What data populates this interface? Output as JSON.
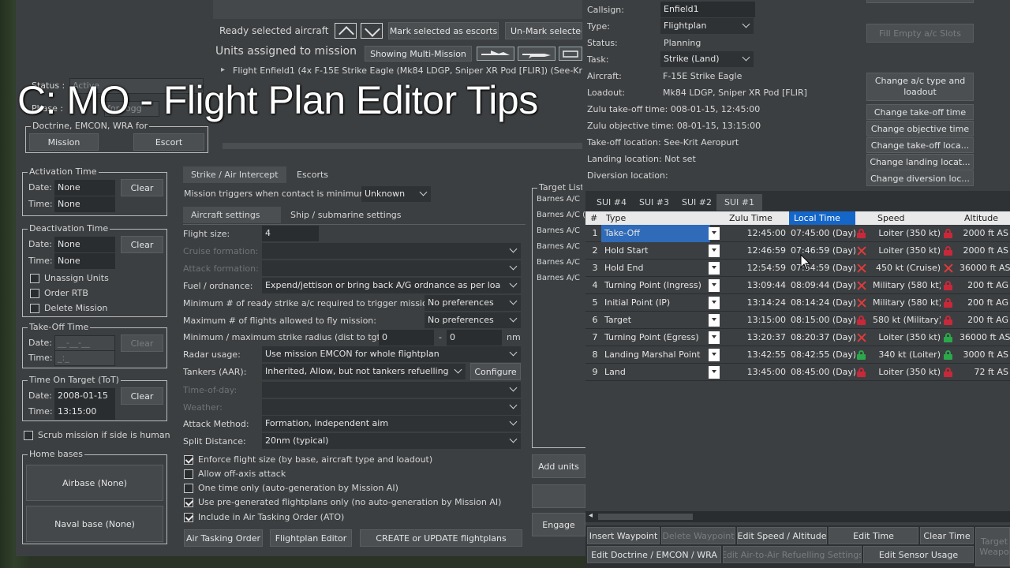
{
  "overlay": {
    "title": "C: MO - Flight Plan Editor Tips"
  },
  "mission_top": {
    "status_label": "Status :",
    "status_value": "Active",
    "phase_label": "Phase :",
    "phase_value": "for togg",
    "doctrine_legend": "Doctrine, EMCON, WRA for",
    "mission_btn": "Mission",
    "escort_btn": "Escort",
    "ready_selected": "Ready selected aircraft",
    "mark_escorts": "Mark selected as escorts",
    "unmark_selected": "Un-Mark selected",
    "units_assigned": "Units assigned to mission",
    "showing_multi": "Showing Multi-Mission",
    "flight_line": "Flight Enfield1 (4x F-15E Strike Eagle (Mk84 LDGP, Sniper XR Pod [FLIR]) (See-Krit Aerop"
  },
  "activation": {
    "legend": "Activation Time",
    "date_label": "Date:",
    "date": "None",
    "time_label": "Time:",
    "time": "None",
    "clear": "Clear"
  },
  "deactivation": {
    "legend": "Deactivation Time",
    "date_label": "Date:",
    "date": "None",
    "time_label": "Time:",
    "time": "None",
    "clear": "Clear",
    "unassign": "Unassign Units",
    "order_rtb": "Order RTB",
    "delete_mission": "Delete Mission"
  },
  "takeoff": {
    "legend": "Take-Off Time",
    "date_label": "Date:",
    "date": "__-__-__",
    "time_label": "Time:",
    "time": "_:_",
    "clear": "Clear"
  },
  "tot": {
    "legend": "Time On Target (ToT)",
    "date_label": "Date:",
    "date": "2008-01-15",
    "time_label": "Time:",
    "time": "13:15:00",
    "clear": "Clear"
  },
  "scrub": "Scrub mission if side is human",
  "home_bases": {
    "legend": "Home bases",
    "airbase": "Airbase (None)",
    "naval": "Naval base (None)"
  },
  "tabs": {
    "strike": "Strike / Air Intercept",
    "escorts": "Escorts",
    "aircraft_settings": "Aircraft settings",
    "ship_settings": "Ship / submarine settings"
  },
  "settings": {
    "triggers_label": "Mission triggers when contact is minimum:",
    "triggers_value": "Unknown",
    "flight_size_label": "Flight size:",
    "flight_size": "4",
    "cruise_formation": "Cruise formation:",
    "attack_formation": "Attack formation:",
    "fuel_label": "Fuel / ordnance:",
    "fuel_value": "Expend/jettison or bring back A/G ordnance as per loa",
    "min_ready_label": "Minimum # of ready strike a/c required to trigger mission:",
    "min_ready_value": "No preferences",
    "max_flights_label": "Maximum # of flights allowed to fly mission:",
    "max_flights_value": "No preferences",
    "radius_label": "Minimum / maximum strike radius (dist to tgt):",
    "radius_min": "0",
    "radius_max": "0",
    "radius_unit": "nm",
    "radar_label": "Radar usage:",
    "radar_value": "Use mission EMCON for whole flightplan",
    "tankers_label": "Tankers (AAR):",
    "tankers_value": "Inherited, Allow, but not tankers refuelling",
    "configure": "Configure",
    "time_of_day": "Time-of-day:",
    "weather": "Weather:",
    "attack_method_label": "Attack Method:",
    "attack_method_value": "Formation, independent aim",
    "split_label": "Split Distance:",
    "split_value": "20nm (typical)",
    "enforce": "Enforce flight size (by base, aircraft type and loadout)",
    "off_axis": "Allow off-axis attack",
    "one_time": "One time only (auto-generation by Mission AI)",
    "pregenerated": "Use pre-generated flightplans only (no auto-generation by Mission AI)",
    "ato": "Include in Air Tasking Order (ATO)",
    "btn_ato": "Air Tasking Order",
    "btn_fpe": "Flightplan Editor",
    "btn_create": "CREATE or UPDATE flightplans"
  },
  "target_list": {
    "legend": "Target List",
    "items": [
      "Barnes A/C (",
      "Barnes A/C (",
      "Barnes A/C",
      "Barnes A/C",
      "Barnes A/C",
      "Barnes A/C"
    ],
    "add_units": "Add units",
    "engage": "Engage"
  },
  "flight_info": {
    "callsign_label": "Callsign:",
    "callsign": "Enfield1",
    "type_label": "Type:",
    "type": "Flightplan",
    "status_label": "Status:",
    "status": "Planning",
    "task_label": "Task:",
    "task": "Strike (Land)",
    "aircraft_label": "Aircraft:",
    "aircraft": "F-15E Strike Eagle",
    "loadout_label": "Loadout:",
    "loadout": "Mk84 LDGP, Sniper XR Pod [FLIR]",
    "zulu_takeoff": "Zulu take-off time: 008-01-15, 12:45:00",
    "zulu_objective": "Zulu objective time: 08-01-15, 13:15:00",
    "takeoff_loc": "Take-off location: See-Krit Aeropurt",
    "landing_loc": "Landing location: Not set",
    "diversion_loc": "Diversion location:"
  },
  "right_buttons": {
    "fill_empty": "Fill Empty a/c Slots",
    "change_type": "Change a/c type and loadout",
    "change_takeoff_time": "Change take-off time",
    "change_objective_time": "Change objective time",
    "change_takeoff_loc": "Change  take-off loca...",
    "change_landing_loc": "Change  landing locat...",
    "change_diversion_loc": "Change  diversion loc..."
  },
  "sui_tabs": [
    "SUI #4",
    "SUI #3",
    "SUI #2",
    "SUI #1"
  ],
  "grid_headers": {
    "num": "#",
    "type": "Type",
    "zulu": "Zulu Time",
    "local": "Local Time",
    "speed": "Speed",
    "altitude": "Altitude"
  },
  "waypoints": [
    {
      "n": "1",
      "type": "Take-Off",
      "zulu": "12:45:00",
      "local": "07:45:00 (Day)",
      "tlock": "red-lock",
      "speed": "Loiter (350 kt)",
      "slock": "red-lock",
      "alt": "2000 ft AS"
    },
    {
      "n": "2",
      "type": "Hold Start",
      "zulu": "12:46:59",
      "local": "07:46:59 (Day)",
      "tlock": "x",
      "speed": "Loiter (350 kt)",
      "slock": "red-lock",
      "alt": "2000 ft AS"
    },
    {
      "n": "3",
      "type": "Hold End",
      "zulu": "12:54:59",
      "local": "07:54:59 (Day)",
      "tlock": "x",
      "speed": "450 kt (Cruise)",
      "slock": "x",
      "alt": "36000 ft AS"
    },
    {
      "n": "4",
      "type": "Turning Point (Ingress)",
      "zulu": "13:09:44",
      "local": "08:09:44 (Day)",
      "tlock": "x",
      "speed": "Military (580 kt)",
      "slock": "red-lock",
      "alt": "200 ft AG"
    },
    {
      "n": "5",
      "type": "Initial Point (IP)",
      "zulu": "13:14:24",
      "local": "08:14:24 (Day)",
      "tlock": "x",
      "speed": "Military (580 kt)",
      "slock": "red-lock",
      "alt": "200 ft AG"
    },
    {
      "n": "6",
      "type": "Target",
      "zulu": "13:15:00",
      "local": "08:15:00 (Day)",
      "tlock": "red-lock",
      "speed": "580 kt (Military)",
      "slock": "red-lock",
      "alt": "200 ft AG"
    },
    {
      "n": "7",
      "type": "Turning Point (Egress)",
      "zulu": "13:20:37",
      "local": "08:20:37 (Day)",
      "tlock": "x",
      "speed": "Loiter (350 kt)",
      "slock": "green-lock",
      "alt": "36000 ft AS"
    },
    {
      "n": "8",
      "type": "Landing Marshal Point",
      "zulu": "13:42:55",
      "local": "08:42:55 (Day)",
      "tlock": "green-lock",
      "speed": "340 kt (Loiter)",
      "slock": "green-lock",
      "alt": "3000 ft AS"
    },
    {
      "n": "9",
      "type": "Land",
      "zulu": "13:45:00",
      "local": "08:45:00 (Day)",
      "tlock": "red-lock",
      "speed": "Loiter (350 kt)",
      "slock": "red-lock",
      "alt": "72 ft AS"
    }
  ],
  "bottom_buttons": {
    "insert": "Insert Waypoint",
    "delete": "Delete Waypoint",
    "edit_speed_alt": "Edit Speed / Altitude",
    "edit_time": "Edit Time",
    "clear_time": "Clear Time",
    "edit_doctrine": "Edit Doctrine / EMCON / WRA",
    "edit_aar": "Edit Air-to-Air Refuelling Settings",
    "edit_sensor": "Edit Sensor Usage",
    "target_weapons": "Target Weapo"
  },
  "colors": {
    "accent": "#1466c8",
    "red_lock": "#c8283a",
    "green_lock": "#2aa84a"
  }
}
